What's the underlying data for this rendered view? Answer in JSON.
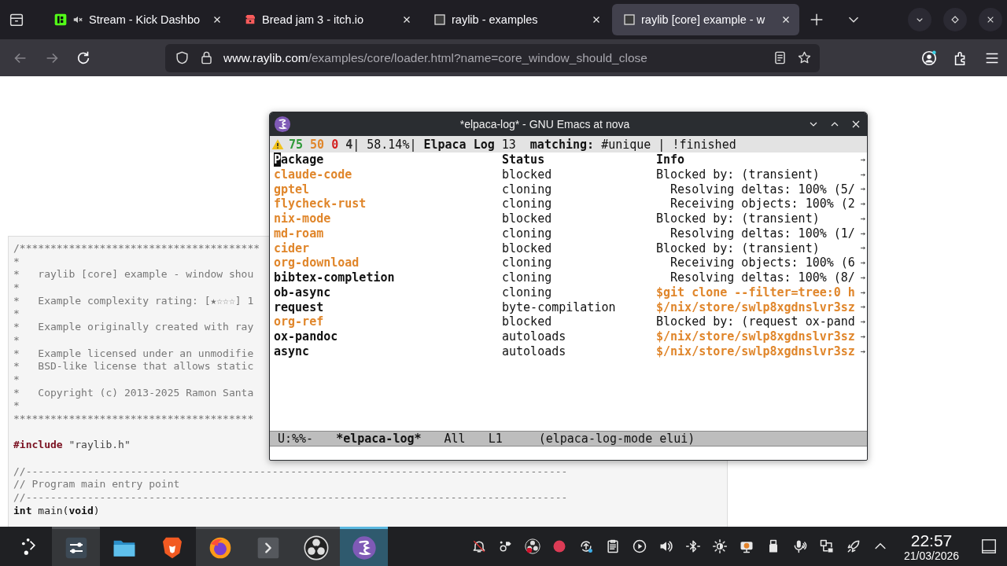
{
  "browser": {
    "tabs": [
      {
        "label": "Stream - Kick Dashbo",
        "kind": "kick",
        "muted": true,
        "selected": false
      },
      {
        "label": "Bread jam 3 - itch.io",
        "kind": "itch",
        "muted": false,
        "selected": false
      },
      {
        "label": "raylib - examples",
        "kind": "raylib",
        "muted": false,
        "selected": false
      },
      {
        "label": "raylib [core] example - w",
        "kind": "raylib",
        "muted": false,
        "selected": true
      }
    ],
    "back_disabled": true,
    "forward_disabled": true,
    "url": {
      "host": "www.raylib.com",
      "path": "/examples/core/loader.html?name=core_window_should_close"
    }
  },
  "code_lines": [
    {
      "kind": "comment",
      "text": "/***************************************"
    },
    {
      "kind": "comment",
      "text": "*"
    },
    {
      "kind": "comment",
      "text": "*   raylib [core] example - window shou"
    },
    {
      "kind": "comment",
      "text": "*"
    },
    {
      "kind": "comment",
      "text": "*   Example complexity rating: [★☆☆☆] 1"
    },
    {
      "kind": "comment",
      "text": "*"
    },
    {
      "kind": "comment",
      "text": "*   Example originally created with ray"
    },
    {
      "kind": "comment",
      "text": "*"
    },
    {
      "kind": "comment",
      "text": "*   Example licensed under an unmodifie"
    },
    {
      "kind": "comment",
      "text": "*   BSD-like license that allows static"
    },
    {
      "kind": "comment",
      "text": "*"
    },
    {
      "kind": "comment",
      "text": "*   Copyright (c) 2013-2025 Ramon Santa"
    },
    {
      "kind": "comment",
      "text": "*"
    },
    {
      "kind": "comment",
      "text": "***************************************"
    },
    {
      "kind": "blank"
    },
    {
      "kind": "code",
      "segments": [
        {
          "kind": "directive",
          "text": "#include"
        },
        {
          "kind": "string",
          "text": " \"raylib.h\""
        }
      ]
    },
    {
      "kind": "blank"
    },
    {
      "kind": "comment",
      "text": "//----------------------------------------------------------------------------------------"
    },
    {
      "kind": "comment",
      "text": "// Program main entry point"
    },
    {
      "kind": "comment",
      "text": "//----------------------------------------------------------------------------------------"
    },
    {
      "kind": "code",
      "segments": [
        {
          "kind": "keyword",
          "text": "int"
        },
        {
          "kind": "plain",
          "text": " main("
        },
        {
          "kind": "keyword",
          "text": "void"
        },
        {
          "kind": "plain",
          "text": ")"
        }
      ]
    }
  ],
  "emacs": {
    "title": "*elpaca-log* - GNU Emacs at nova",
    "header": {
      "counts": [
        {
          "value": "75",
          "color": "#2f9a3a"
        },
        {
          "value": "50",
          "color": "#e0862b"
        },
        {
          "value": "0",
          "color": "#d42020"
        },
        {
          "value": "4",
          "color": "#333333"
        }
      ],
      "progress": "| 58.14%|",
      "log_title": "Elpaca Log",
      "log_count": "13",
      "filter_label": "matching:",
      "filter": "#unique | !finished"
    },
    "columns": [
      "Package",
      "Status",
      "Info"
    ],
    "rows": [
      {
        "kind": "message",
        "package": "claude-code",
        "color": "#e0862b",
        "status": "blocked",
        "info": "Blocked by: (transient)"
      },
      {
        "kind": "message",
        "package": "gptel",
        "color": "#e0862b",
        "status": "cloning",
        "info": "  Resolving deltas: 100% (5/"
      },
      {
        "kind": "message",
        "package": "flycheck-rust",
        "color": "#e0862b",
        "status": "cloning",
        "info": "  Receiving objects: 100% (2"
      },
      {
        "kind": "message",
        "package": "nix-mode",
        "color": "#e0862b",
        "status": "blocked",
        "info": "Blocked by: (transient)"
      },
      {
        "kind": "message",
        "package": "md-roam",
        "color": "#e0862b",
        "status": "cloning",
        "info": "  Resolving deltas: 100% (1/"
      },
      {
        "kind": "message",
        "package": "cider",
        "color": "#e0862b",
        "status": "blocked",
        "info": "Blocked by: (transient)"
      },
      {
        "kind": "message",
        "package": "org-download",
        "color": "#e0862b",
        "status": "cloning",
        "info": "  Receiving objects: 100% (6"
      },
      {
        "kind": "message",
        "package": "bibtex-completion",
        "color": "#111111",
        "status": "cloning",
        "info": "  Resolving deltas: 100% (8/"
      },
      {
        "kind": "command",
        "package": "ob-async",
        "color": "#111111",
        "status": "cloning",
        "info": "$git clone --filter=tree:0 h"
      },
      {
        "kind": "command",
        "package": "request",
        "color": "#111111",
        "status": "byte-compilation",
        "info": "$/nix/store/swlp8xgdnslvr3sz"
      },
      {
        "kind": "message",
        "package": "org-ref",
        "color": "#e0862b",
        "status": "blocked",
        "info": "Blocked by: (request ox-pand"
      },
      {
        "kind": "command",
        "package": "ox-pandoc",
        "color": "#111111",
        "status": "autoloads",
        "info": "$/nix/store/swlp8xgdnslvr3sz"
      },
      {
        "kind": "command",
        "package": "async",
        "color": "#111111",
        "status": "autoloads",
        "info": "$/nix/store/swlp8xgdnslvr3sz"
      }
    ],
    "mode_line": {
      "state": "U:%%-",
      "buffer": "*elpaca-log*",
      "position": "All",
      "line": "L1",
      "mode": "(elpaca-log-mode elui)"
    }
  },
  "taskbar": {
    "apps": [
      {
        "kind": "mixer",
        "running": true,
        "selected": false
      },
      {
        "kind": "files",
        "running": false,
        "selected": false
      },
      {
        "kind": "brave",
        "running": false,
        "selected": false
      },
      {
        "kind": "firefox",
        "running": true,
        "selected": false
      },
      {
        "kind": "terminal",
        "running": true,
        "selected": false
      },
      {
        "kind": "obs",
        "running": true,
        "selected": false
      },
      {
        "kind": "emacs",
        "running": true,
        "selected": true
      }
    ],
    "tray": [
      {
        "kind": "bell_off"
      },
      {
        "kind": "connect"
      },
      {
        "kind": "obs"
      },
      {
        "kind": "record"
      },
      {
        "kind": "update"
      },
      {
        "kind": "clipboard"
      },
      {
        "kind": "media"
      },
      {
        "kind": "volume"
      },
      {
        "kind": "bluetooth"
      },
      {
        "kind": "brightness"
      },
      {
        "kind": "webcam"
      },
      {
        "kind": "usb"
      },
      {
        "kind": "microphone"
      },
      {
        "kind": "network"
      },
      {
        "kind": "rocket"
      },
      {
        "kind": "expand"
      }
    ],
    "time": "22:57",
    "date": "21/03/2026"
  }
}
